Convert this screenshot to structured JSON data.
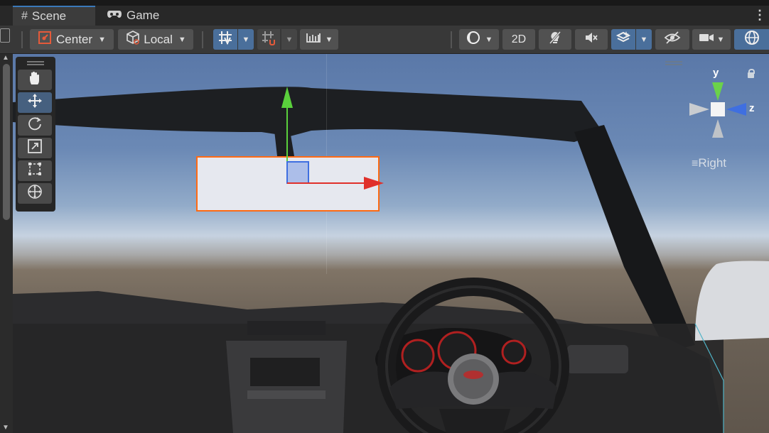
{
  "tabs": [
    {
      "label": "Scene",
      "icon": "hash-grid-icon",
      "active": true
    },
    {
      "label": "Game",
      "icon": "gamepad-icon",
      "active": false
    }
  ],
  "toolbar": {
    "pivot_label": "Center",
    "space_label": "Local",
    "mode_2d_label": "2D"
  },
  "scene_view": {
    "perspective_label": "Right",
    "gizmo_axes": {
      "y": "y",
      "z": "z"
    }
  },
  "colors": {
    "accent": "#4a6f9b",
    "selection_outline": "#ff6a14",
    "x_axis": "#e0302a",
    "y_axis": "#5ad03c",
    "z_axis": "#3f6fe0"
  },
  "tools": [
    "hand-tool",
    "move-tool",
    "rotate-tool",
    "scale-tool",
    "rect-tool",
    "transform-tool"
  ]
}
